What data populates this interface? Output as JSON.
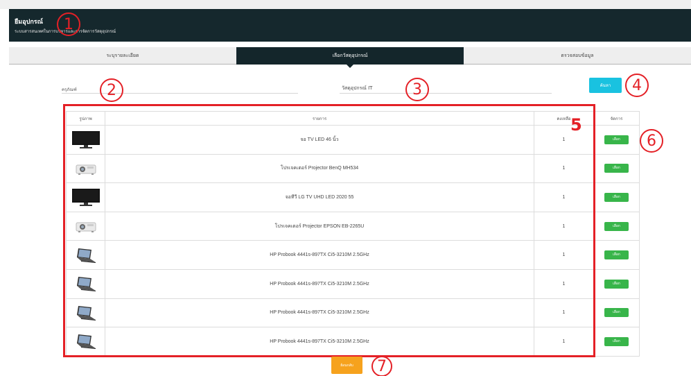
{
  "header": {
    "title": "ยืมอุปกรณ์",
    "subtitle": "ระบบสารสนเทศในการบริหารและการจัดการวัสดุอุปกรณ์"
  },
  "tabs": [
    {
      "label": "ระบุรายละเอียด",
      "active": false
    },
    {
      "label": "เลือกวัสดุอุปกรณ์",
      "active": true
    },
    {
      "label": "ตรวจสอบข้อมูล",
      "active": false
    }
  ],
  "form": {
    "equipment_label": "ครุภัณฑ์",
    "equipment_value": "",
    "supply_label": "วัสดุอุปกรณ์ IT",
    "search_label": "ค้นหา"
  },
  "table": {
    "headers": {
      "image": "รูปภาพ",
      "item": "รายการ",
      "remaining": "คงเหลือ",
      "action": "จัดการ"
    },
    "select_label": "เลือก",
    "rows": [
      {
        "icon": "tv-icon",
        "name": "จอ TV LED 46 นิ้ว",
        "qty": "1"
      },
      {
        "icon": "projector-icon",
        "name": "โปรเจคเตอร์ Projector BenQ MH534",
        "qty": "1"
      },
      {
        "icon": "tv-icon",
        "name": "จอทีวี LG TV UHD LED 2020 55",
        "qty": "1"
      },
      {
        "icon": "projector-icon",
        "name": "โปรเจคเตอร์ Projector EPSON EB-2265U",
        "qty": "1"
      },
      {
        "icon": "laptop-icon",
        "name": "HP Probook 4441s-897TX Ci5-3210M 2.5GHz",
        "qty": "1"
      },
      {
        "icon": "laptop-icon",
        "name": "HP Probook 4441s-897TX Ci5-3210M 2.5GHz",
        "qty": "1"
      },
      {
        "icon": "laptop-icon",
        "name": "HP Probook 4441s-897TX Ci5-3210M 2.5GHz",
        "qty": "1"
      },
      {
        "icon": "laptop-icon",
        "name": "HP Probook 4441s-897TX Ci5-3210M 2.5GHz",
        "qty": "1"
      }
    ]
  },
  "back_label": "ย้อนกลับ",
  "callouts": [
    "1",
    "2",
    "3",
    "4",
    "5",
    "6",
    "7"
  ],
  "colors": {
    "header_bg": "#15282d",
    "search_button": "#19c2e0",
    "select_button": "#38b54a",
    "back_button": "#f6a21d",
    "annotation": "#e42026"
  }
}
